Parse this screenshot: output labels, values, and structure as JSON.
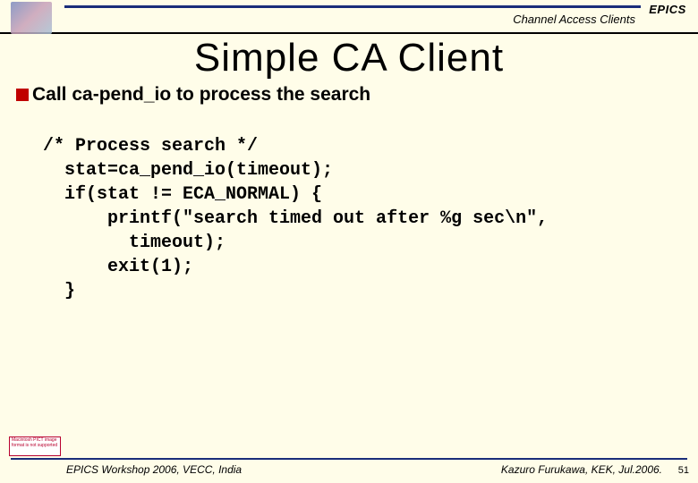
{
  "header": {
    "category": "Channel Access Clients",
    "logo_text": "EPICS"
  },
  "title": "Simple CA Client",
  "bullet": "Call ca-pend_io to process the search",
  "code": "/* Process search */\n  stat=ca_pend_io(timeout);\n  if(stat != ECA_NORMAL) {\n      printf(\"search timed out after %g sec\\n\",\n        timeout);\n      exit(1);\n  }",
  "placeholder_text": "Macintosh PICT image format is not supported",
  "footer": {
    "left": "EPICS Workshop 2006, VECC, India",
    "right": "Kazuro Furukawa, KEK, Jul.2006.",
    "page": "51"
  }
}
